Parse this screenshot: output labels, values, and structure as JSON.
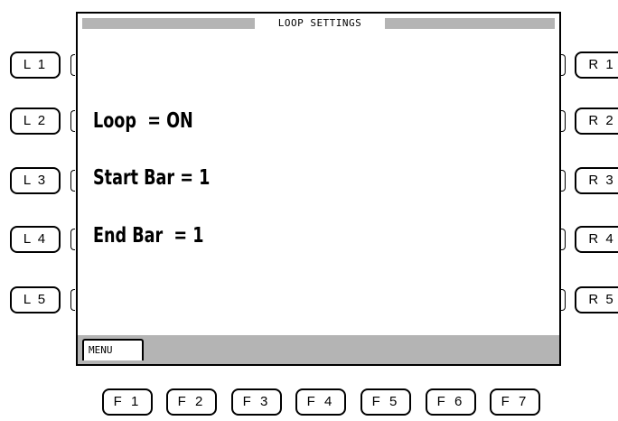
{
  "screen": {
    "title": "LOOP SETTINGS",
    "params": {
      "loop": "Loop  = ON",
      "start_bar": "Start Bar = 1",
      "end_bar": "End Bar  = 1"
    },
    "menu_label": "MENU"
  },
  "left_buttons": [
    "L 1",
    "L 2",
    "L 3",
    "L 4",
    "L 5"
  ],
  "right_buttons": [
    "R 1",
    "R 2",
    "R 3",
    "R 4",
    "R 5"
  ],
  "function_buttons": [
    "F 1",
    "F 2",
    "F 3",
    "F 4",
    "F 5",
    "F 6",
    "F 7"
  ],
  "colors": {
    "bar_gray": "#b4b4b4",
    "border": "#000000",
    "background": "#ffffff"
  }
}
